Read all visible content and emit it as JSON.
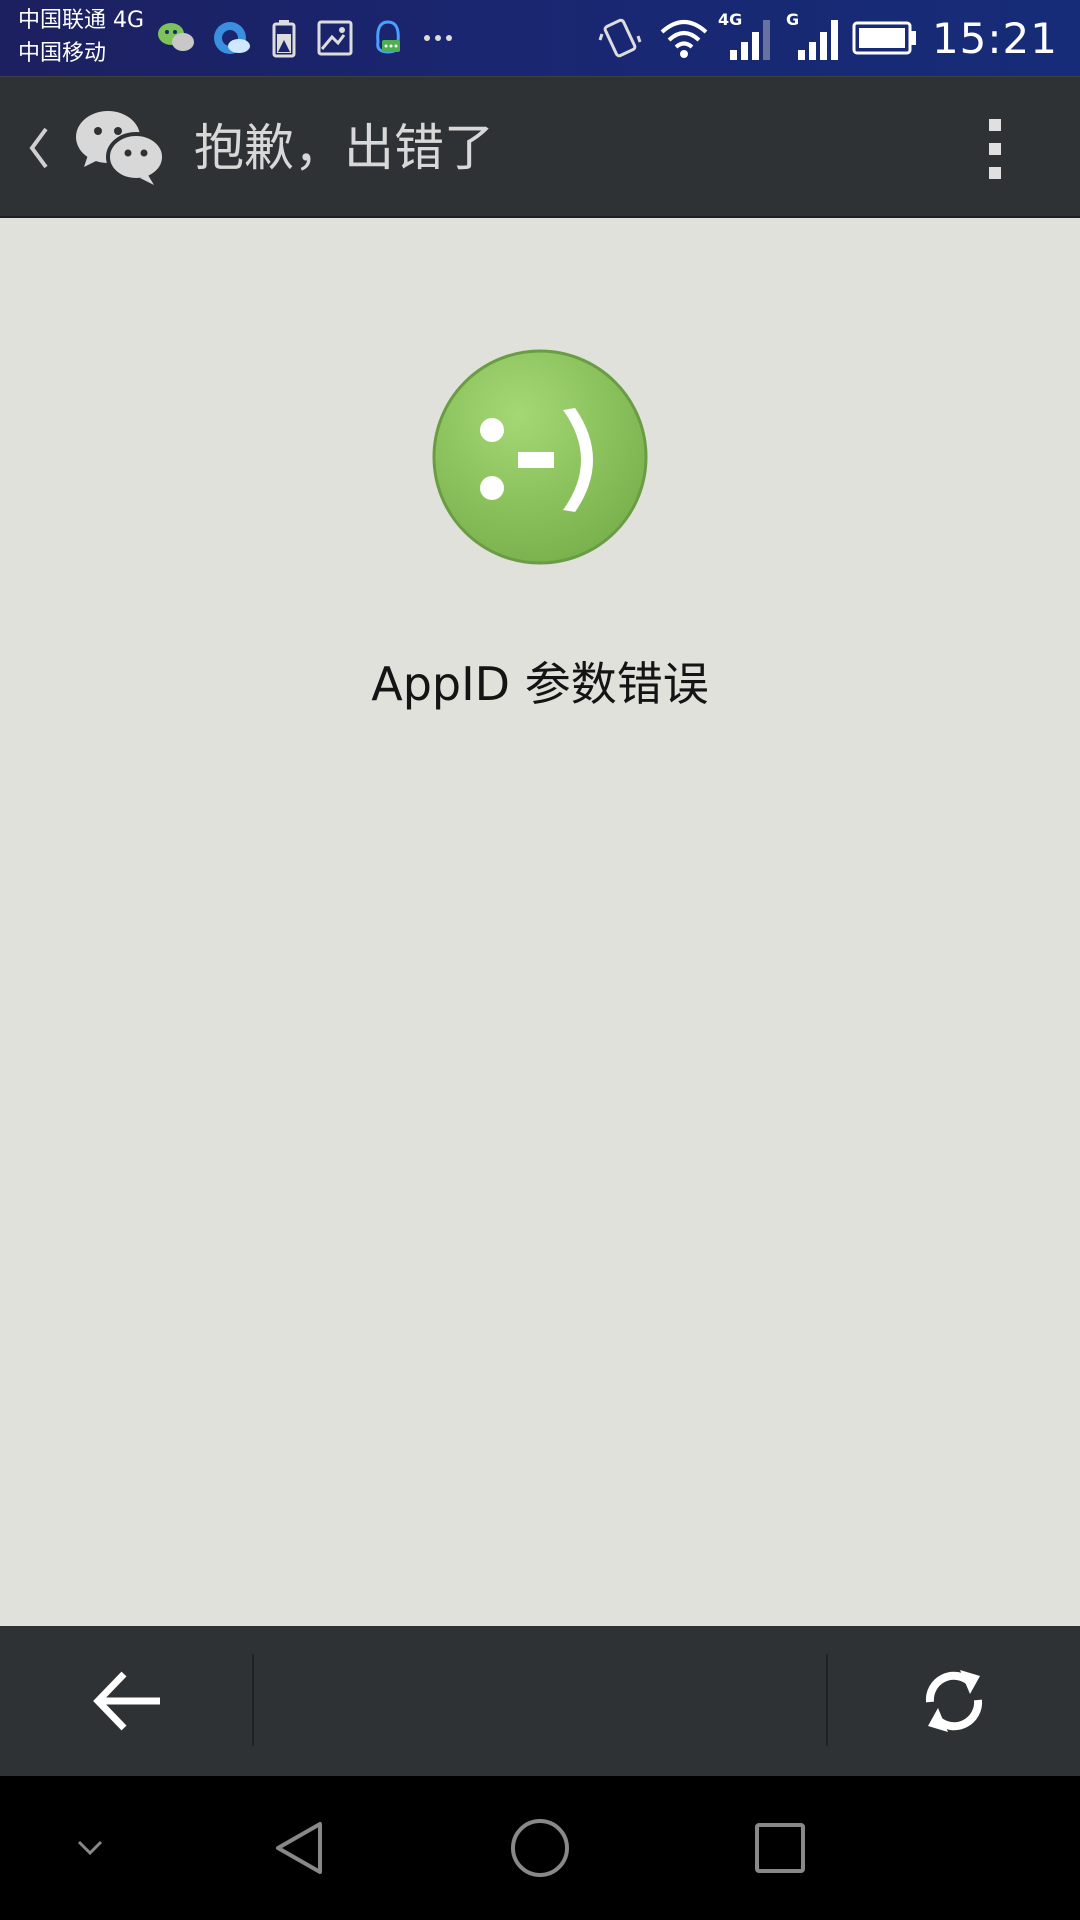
{
  "status_bar": {
    "carrier_1": "中国联通 4G",
    "carrier_2": "中国移动",
    "network_badge_1": "4G",
    "network_badge_2": "G",
    "time": "15:21",
    "notification_icons": [
      "wechat-icon",
      "browser-icon",
      "battery-warning-icon",
      "image-icon",
      "qq-icon",
      "more-dots-icon"
    ],
    "system_icons": [
      "vibrate-icon",
      "wifi-icon",
      "signal-4g-icon",
      "signal-g-icon",
      "battery-icon"
    ]
  },
  "header": {
    "title": "抱歉，出错了",
    "back_icon": "chevron-left-icon",
    "logo_icon": "wechat-logo-icon",
    "menu_icon": "more-vertical-icon"
  },
  "content": {
    "face_text": ":-)",
    "message": "AppID 参数错误"
  },
  "toolbar": {
    "back_icon": "arrow-left-icon",
    "refresh_icon": "refresh-icon"
  },
  "nav_bar": {
    "items": [
      "collapse-chevron-icon",
      "back-triangle-icon",
      "home-circle-icon",
      "recents-square-icon"
    ]
  },
  "colors": {
    "status_bar": "#1a2670",
    "header": "#2e3234",
    "content_bg": "#e1e1dc",
    "smiley_green": "#8cc460",
    "nav_bar": "#000000"
  }
}
